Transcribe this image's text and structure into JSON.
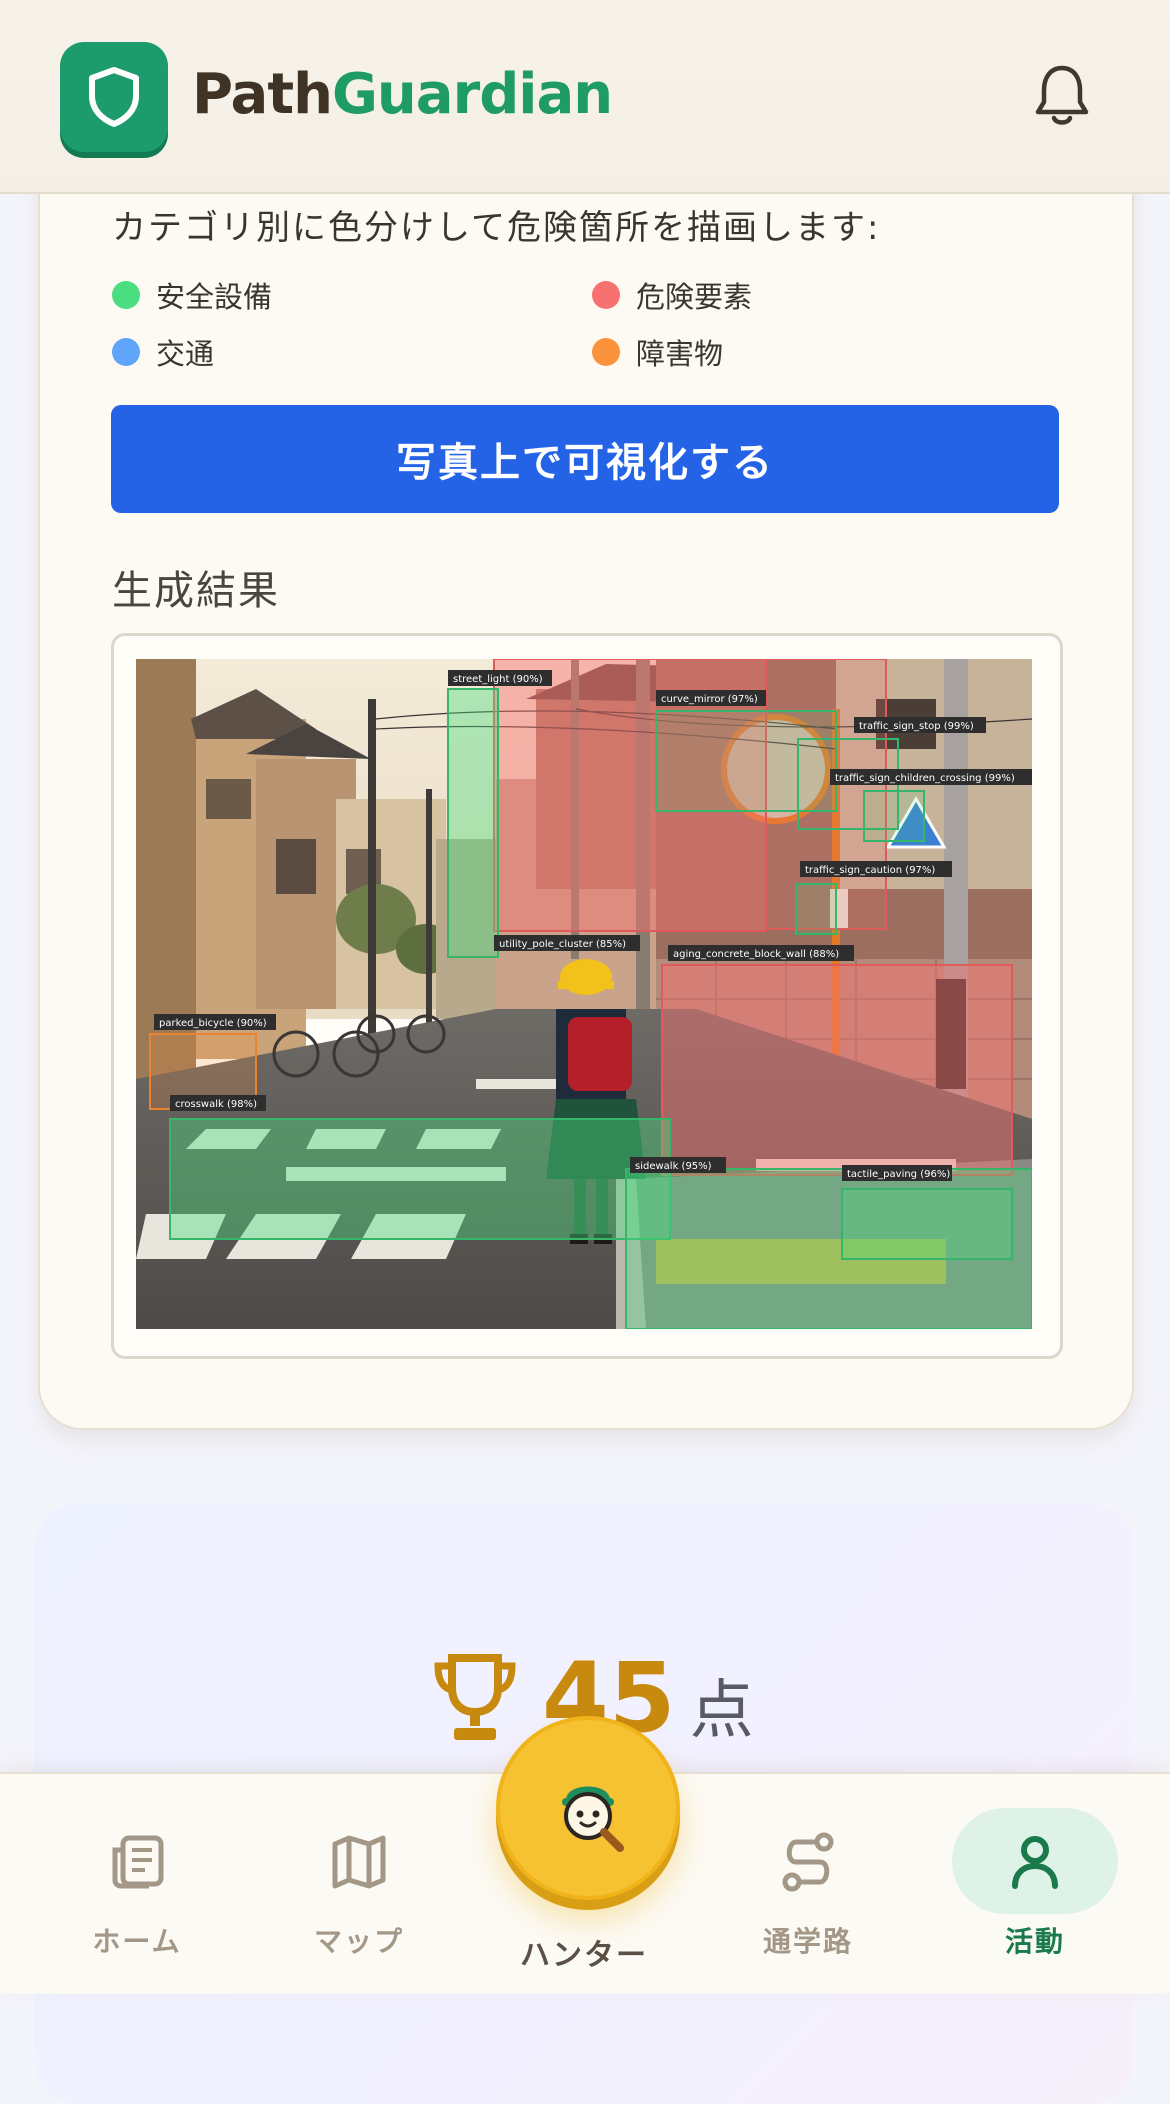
{
  "header": {
    "brand_part1": "Path",
    "brand_part2": "Guardian",
    "logo_icon": "shield-icon",
    "notification_icon": "bell-icon"
  },
  "visualize": {
    "intro": "カテゴリ別に色分けして危険箇所を描画します:",
    "legend": [
      {
        "label": "安全設備",
        "color": "#4ade80"
      },
      {
        "label": "危険要素",
        "color": "#f87171"
      },
      {
        "label": "交通",
        "color": "#60a5fa"
      },
      {
        "label": "障害物",
        "color": "#fb923c"
      }
    ],
    "button_label": "写真上で可視化する",
    "result_title": "生成結果",
    "detections": [
      {
        "label": "street_light (90%)",
        "category": "safety"
      },
      {
        "label": "curve_mirror (97%)",
        "category": "safety"
      },
      {
        "label": "traffic_sign_stop (99%)",
        "category": "safety"
      },
      {
        "label": "traffic_sign_children_crossing (99%)",
        "category": "safety"
      },
      {
        "label": "traffic_sign_caution (97%)",
        "category": "safety"
      },
      {
        "label": "utility_pole_cluster (85%)",
        "category": "danger"
      },
      {
        "label": "aging_concrete_block_wall (88%)",
        "category": "danger"
      },
      {
        "label": "parked_bicycle (90%)",
        "category": "obstacle"
      },
      {
        "label": "crosswalk (98%)",
        "category": "safety"
      },
      {
        "label": "sidewalk (95%)",
        "category": "safety"
      },
      {
        "label": "tactile_paving (96%)",
        "category": "safety"
      }
    ]
  },
  "score": {
    "value": "45",
    "unit": "点",
    "icon": "trophy-icon"
  },
  "nav": {
    "items": [
      {
        "label": "ホーム",
        "icon": "home-document-icon"
      },
      {
        "label": "マップ",
        "icon": "map-icon"
      },
      {
        "label": "ハンター",
        "icon": "hunter-mascot-icon"
      },
      {
        "label": "通学路",
        "icon": "route-icon"
      },
      {
        "label": "活動",
        "icon": "user-icon"
      }
    ],
    "active": "活動"
  },
  "colors": {
    "primary_button": "#2563e6",
    "brand_green": "#1f9b66",
    "active_nav": "#1a7a4c",
    "score": "#c78a0f"
  }
}
